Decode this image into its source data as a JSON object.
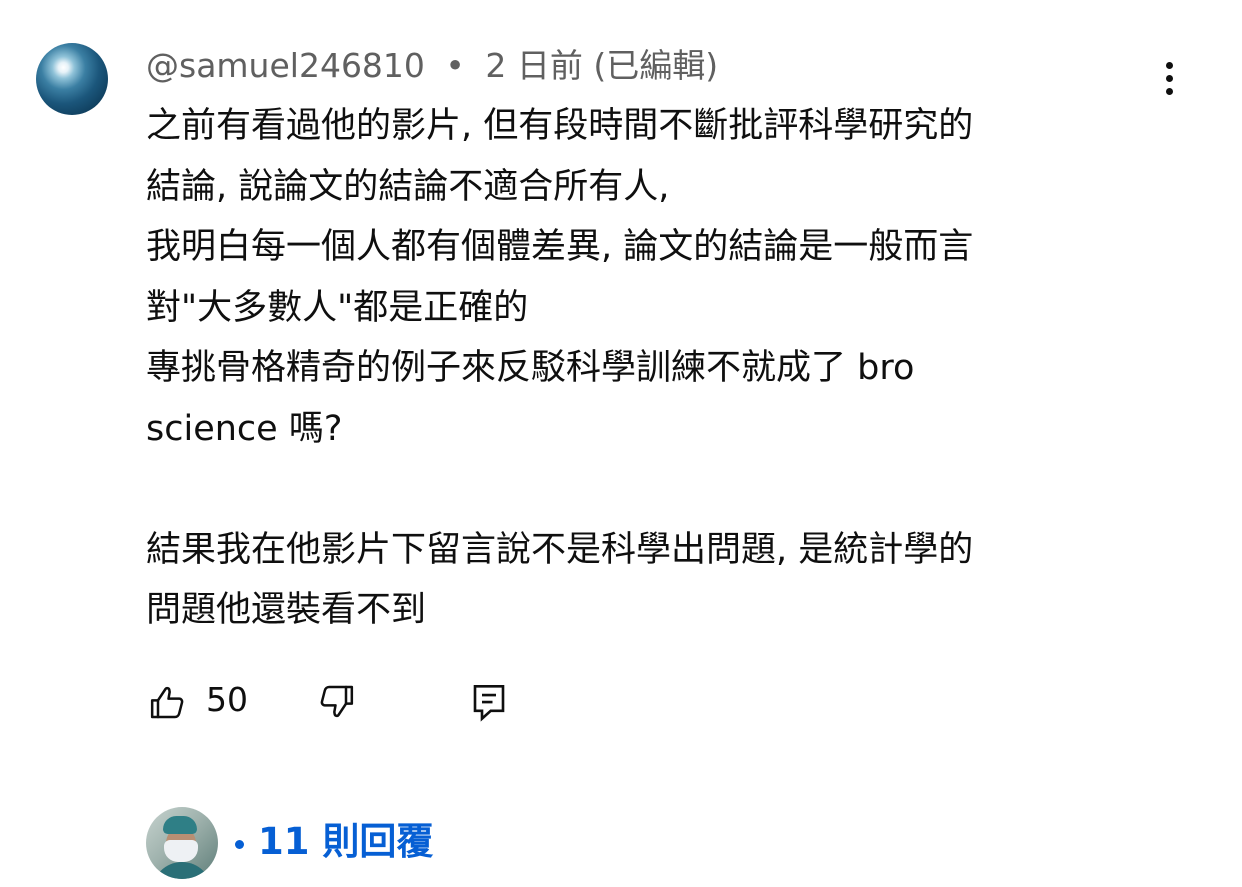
{
  "comment": {
    "author": "@samuel246810",
    "separator": "•",
    "time": "2 日前",
    "edited": "(已編輯)",
    "text": "之前有看過他的影片, 但有段時間不斷批評科學研究的\n結論, 說論文的結論不適合所有人,\n我明白每一個人都有個體差異, 論文的結論是一般而言\n對\"大多數人\"都是正確的\n專挑骨格精奇的例子來反駁科學訓練不就成了 bro\nscience 嗎?\n\n結果我在他影片下留言說不是科學出問題, 是統計學的\n問題他還裝看不到",
    "like_count": "50",
    "icons": {
      "more": "more-vert-icon",
      "like": "thumbs-up-icon",
      "dislike": "thumbs-down-icon",
      "reply": "reply-comment-icon"
    }
  },
  "replies": {
    "separator": "•",
    "label": "11 則回覆",
    "color": "#065fd4"
  }
}
